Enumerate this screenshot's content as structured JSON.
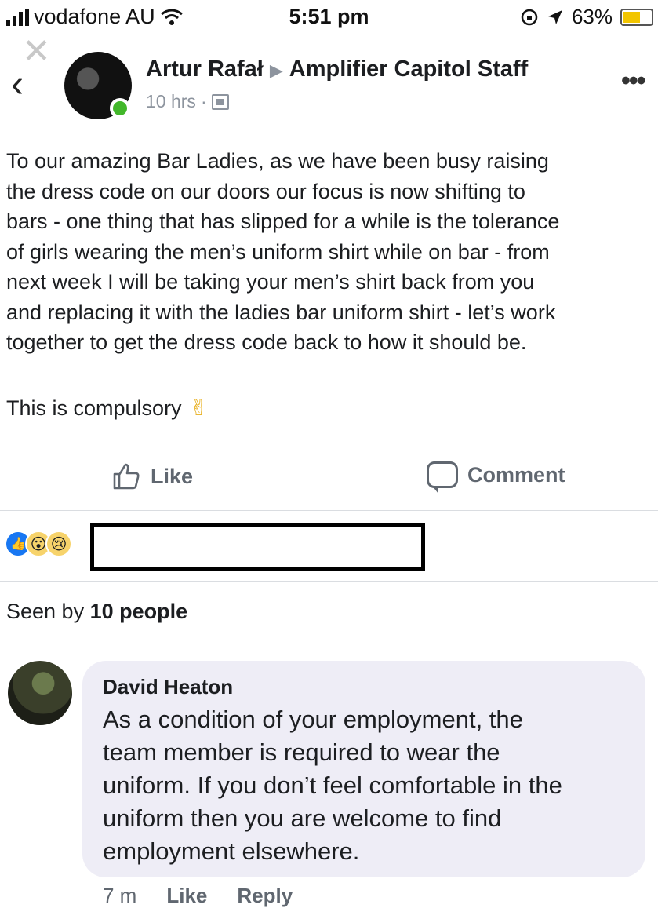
{
  "status_bar": {
    "carrier": "vodafone AU",
    "time": "5:51 pm",
    "battery_percent": "63%",
    "battery_level": 0.63,
    "icons": [
      "signal-icon",
      "wifi-icon",
      "rotation-lock-icon",
      "location-arrow-icon",
      "battery-icon"
    ]
  },
  "post": {
    "author": "Artur Rafał",
    "group": "Amplifier Capitol Staff",
    "time": "10 hrs",
    "separator": "·",
    "body_lines": [
      "To our amazing Bar Ladies, as we have been busy raising",
      "the  dress code on our doors our focus is now shifting to",
      "bars - one thing that has slipped for a while is the tolerance",
      "of girls wearing the men’s uniform shirt while on bar - from",
      "next week I will be taking your men’s shirt back from you",
      "and replacing it with the ladies bar uniform shirt - let’s work",
      "together to get the dress code back to how it should be."
    ],
    "closing": "This is compulsory",
    "closing_emoji": "✌",
    "actions": {
      "like": "Like",
      "comment": "Comment"
    },
    "reactions": [
      "like",
      "wow",
      "sad"
    ],
    "seen_by_prefix": "Seen by",
    "seen_by_count": "10 people"
  },
  "comment": {
    "author": "David Heaton",
    "text_lines": [
      "As a condition of your employment, the",
      "team member is required to wear the",
      "uniform. If you don’t feel comfortable in the",
      "uniform then you are welcome to find",
      "employment elsewhere."
    ],
    "time": "7 m",
    "like_label": "Like",
    "reply_label": "Reply"
  },
  "colors": {
    "online": "#42b72a",
    "link_grey": "#606770",
    "meta_grey": "#8d949e",
    "comment_bg": "#eeedf6",
    "like_blue": "#1877f2",
    "battery_fill": "#f2c500"
  }
}
